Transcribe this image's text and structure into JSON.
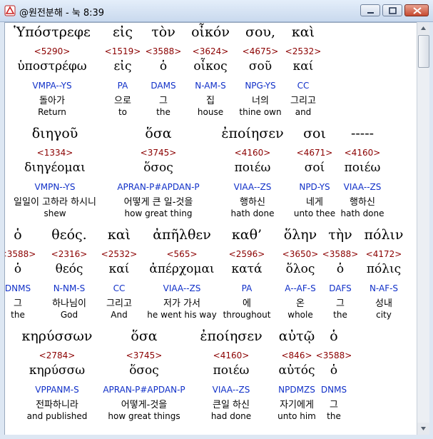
{
  "window": {
    "title": "@원전분해 - 눅 8:39",
    "accent": "#c9d9ee"
  },
  "rows": [
    {
      "words": [
        {
          "greek": "Ὑπόστρεφε",
          "strong": "<5290>",
          "lemma": "ὑποστρέφω",
          "parse": "VMPA--YS",
          "kor": "돌아가",
          "eng": "Return"
        },
        {
          "greek": "εἰς",
          "strong": "<1519>",
          "lemma": "εἰς",
          "parse": "PA",
          "kor": "으로",
          "eng": "to"
        },
        {
          "greek": "τὸν",
          "strong": "<3588>",
          "lemma": "ὁ",
          "parse": "DAMS",
          "kor": "그",
          "eng": "the"
        },
        {
          "greek": "οἶκόν",
          "strong": "<3624>",
          "lemma": "οἶκος",
          "parse": "N-AM-S",
          "kor": "집",
          "eng": "house"
        },
        {
          "greek": "σου,",
          "strong": "<4675>",
          "lemma": "σοῦ",
          "parse": "NPG-YS",
          "kor": "너의",
          "eng": "thine own"
        },
        {
          "greek": "καὶ",
          "strong": "<2532>",
          "lemma": "καί",
          "parse": "CC",
          "kor": "그리고",
          "eng": "and"
        }
      ]
    },
    {
      "words": [
        {
          "greek": "διηγοῦ",
          "strong": "<1334>",
          "lemma": "διηγέομαι",
          "parse": "VMPN--YS",
          "kor": "일일이 고하라 하시니",
          "eng": "shew"
        },
        {
          "greek": "ὅσα",
          "strong": "<3745>",
          "lemma": "ὅσος",
          "parse": "APRAN-P#APDAN-P",
          "kor": "어떻게 큰 일-것을",
          "eng": "how great thing"
        },
        {
          "greek": "ἐποίησεν",
          "strong": "<4160>",
          "lemma": "ποιέω",
          "parse": "VIAA--ZS",
          "kor": "행하신",
          "eng": "hath done"
        },
        {
          "greek": "σοι",
          "strong": "<4671>",
          "lemma": "σοί",
          "parse": "NPD-YS",
          "kor": "네게",
          "eng": "unto thee"
        },
        {
          "greek": "-----",
          "strong": "<4160>",
          "lemma": "ποιέω",
          "parse": "VIAA--ZS",
          "kor": "행하신",
          "eng": "hath done"
        }
      ]
    },
    {
      "words": [
        {
          "greek": "ὁ",
          "strong": "<3588>",
          "lemma": "ὁ",
          "parse": "DNMS",
          "kor": "그",
          "eng": "the"
        },
        {
          "greek": "θεός.",
          "strong": "<2316>",
          "lemma": "θεός",
          "parse": "N-NM-S",
          "kor": "하나님이",
          "eng": "God"
        },
        {
          "greek": "καὶ",
          "strong": "<2532>",
          "lemma": "καί",
          "parse": "CC",
          "kor": "그리고",
          "eng": "And"
        },
        {
          "greek": "ἀπῆλθεν",
          "strong": "<565>",
          "lemma": "ἀπέρχομαι",
          "parse": "VIAA--ZS",
          "kor": "저가 가서",
          "eng": "he went his way"
        },
        {
          "greek": "καθ’",
          "strong": "<2596>",
          "lemma": "κατά",
          "parse": "PA",
          "kor": "에",
          "eng": "throughout"
        },
        {
          "greek": "ὅλην",
          "strong": "<3650>",
          "lemma": "ὅλος",
          "parse": "A--AF-S",
          "kor": "온",
          "eng": "whole"
        },
        {
          "greek": "τὴν",
          "strong": "<3588>",
          "lemma": "ὁ",
          "parse": "DAFS",
          "kor": "그",
          "eng": "the"
        },
        {
          "greek": "πόλιν",
          "strong": "<4172>",
          "lemma": "πόλις",
          "parse": "N-AF-S",
          "kor": "성내",
          "eng": "city"
        }
      ]
    },
    {
      "words": [
        {
          "greek": "κηρύσσων",
          "strong": "<2784>",
          "lemma": "κηρύσσω",
          "parse": "VPPANM-S",
          "kor": "전파하니라",
          "eng": "and published"
        },
        {
          "greek": "ὅσα",
          "strong": "<3745>",
          "lemma": "ὅσος",
          "parse": "APRAN-P#APDAN-P",
          "kor": "어떻게-것을",
          "eng": "how great things"
        },
        {
          "greek": "ἐποίησεν",
          "strong": "<4160>",
          "lemma": "ποιέω",
          "parse": "VIAA--ZS",
          "kor": "큰일 하신",
          "eng": "had done"
        },
        {
          "greek": "αὐτῷ",
          "strong": "<846>",
          "lemma": "αὐτός",
          "parse": "NPDMZS",
          "kor": "자기에게",
          "eng": "unto him"
        },
        {
          "greek": "ὁ",
          "strong": "<3588>",
          "lemma": "ὁ",
          "parse": "DNMS",
          "kor": "그",
          "eng": "the"
        }
      ]
    }
  ]
}
